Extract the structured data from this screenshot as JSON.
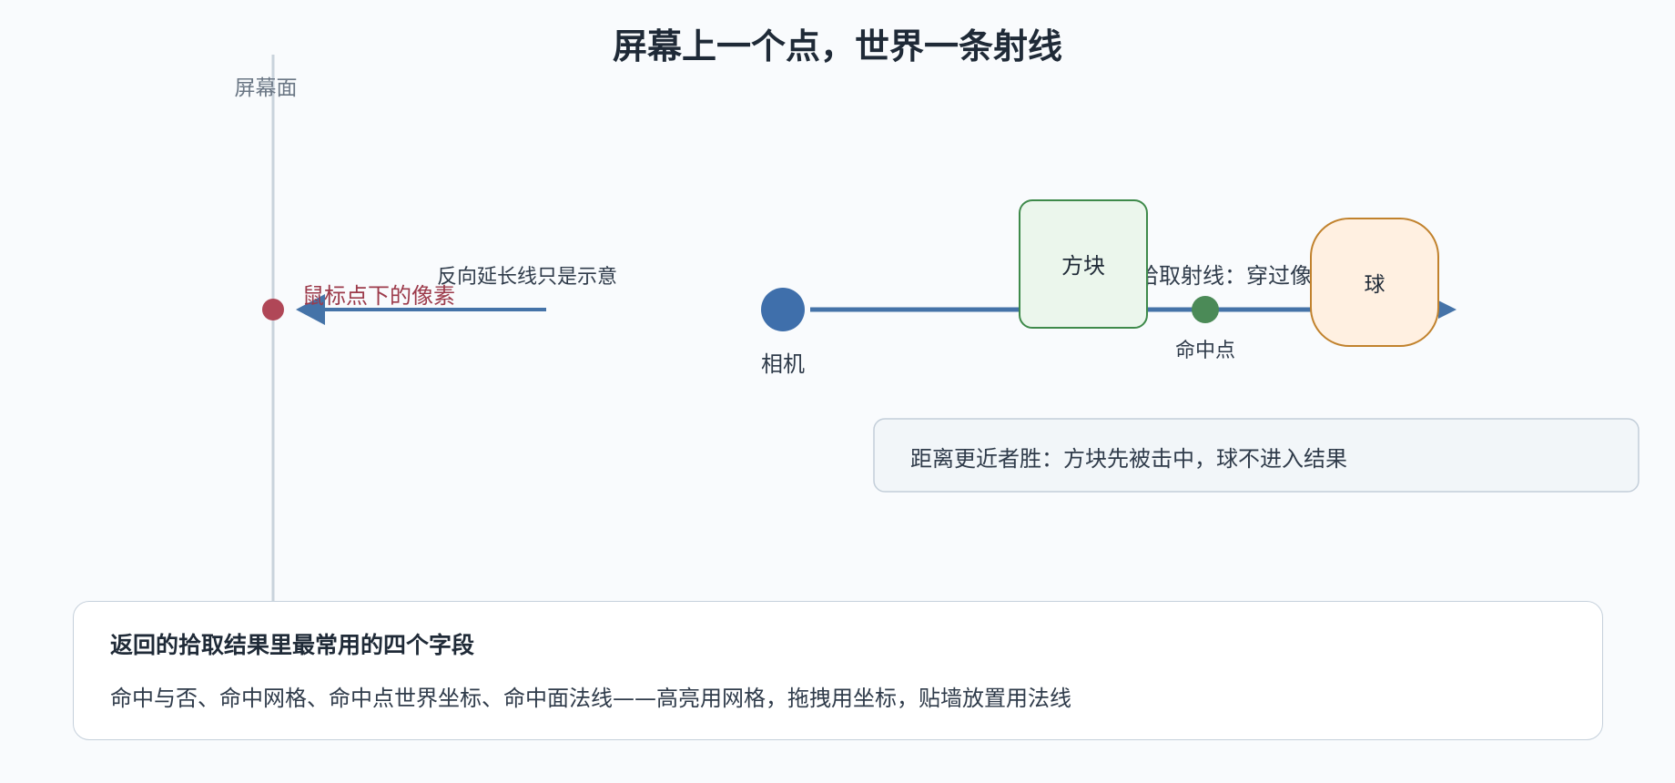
{
  "title": "屏幕上一个点，世界一条射线",
  "screen_plane": {
    "label": "屏幕面"
  },
  "pixel": {
    "label": "鼠标点下的像素"
  },
  "back_line": {
    "label": "反向延长线只是示意"
  },
  "camera": {
    "label": "相机"
  },
  "ray": {
    "label": "拾取射线：穿过像素"
  },
  "box_object": {
    "label": "方块"
  },
  "sphere_object": {
    "label": "球"
  },
  "hit_point": {
    "label": "命中点"
  },
  "note": {
    "text": "距离更近者胜：方块先被击中，球不进入结果"
  },
  "info": {
    "heading": "返回的拾取结果里最常用的四个字段",
    "body": "命中与否、命中网格、命中点世界坐标、命中面法线——高亮用网格，拖拽用坐标，贴墙放置用法线"
  },
  "colors": {
    "ray": "#4573a8",
    "camera": "#3f6fab",
    "pixel": "#b04757",
    "hit": "#4b8a57",
    "box_stroke": "#3e8a4a",
    "box_fill": "#ebf6ec",
    "sphere_stroke": "#c1822d",
    "sphere_fill": "#fff0e1"
  }
}
